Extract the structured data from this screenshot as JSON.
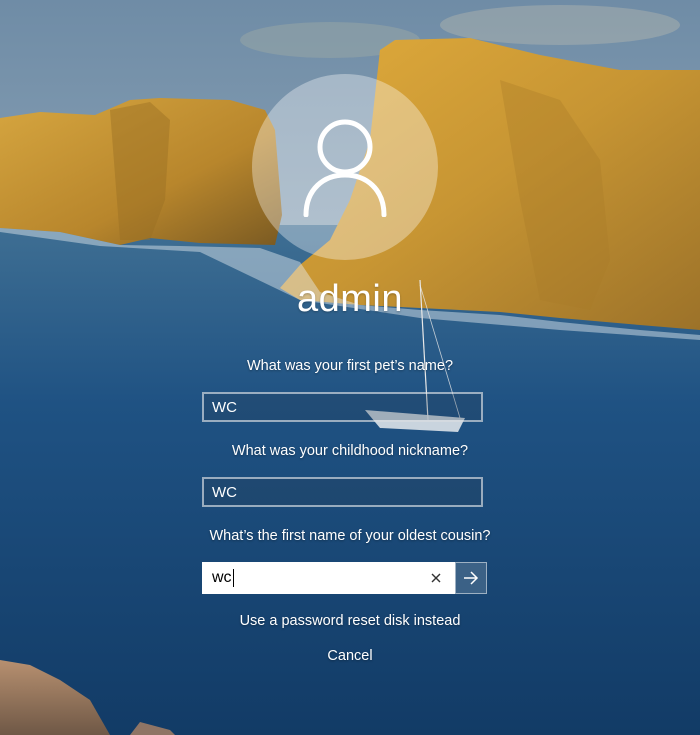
{
  "user": {
    "name": "admin",
    "avatar_icon": "user-silhouette-icon"
  },
  "questions": [
    {
      "label": "What was your first pet’s name?",
      "answer": "WC"
    },
    {
      "label": "What was your childhood nickname?",
      "answer": "WC"
    },
    {
      "label": "What’s the first name of your oldest cousin?",
      "answer": "wc"
    }
  ],
  "active_input": {
    "clear_icon": "clear-x-icon",
    "submit_icon": "arrow-right-icon"
  },
  "links": {
    "reset_disk": "Use a password reset disk instead",
    "cancel": "Cancel"
  },
  "colors": {
    "sky": "#8aa3b8",
    "cliff": "#c9982e",
    "sea": "#1d4a78",
    "text": "#ffffff"
  }
}
